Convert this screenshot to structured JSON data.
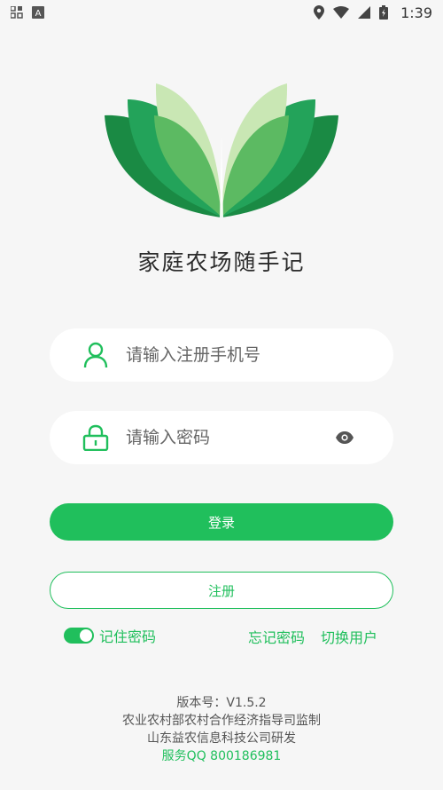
{
  "status_bar": {
    "icons_left": [
      "app-grid-icon",
      "a-badge-icon"
    ],
    "icons_right": [
      "location-icon",
      "wifi-icon",
      "signal-icon",
      "battery-icon"
    ],
    "time": "1:39"
  },
  "app": {
    "title": "家庭农场随手记",
    "logo_icon": "book-leaf-logo"
  },
  "form": {
    "phone_placeholder": "请输入注册手机号",
    "password_placeholder": "请输入密码",
    "phone_value": "",
    "password_value": ""
  },
  "buttons": {
    "login": "登录",
    "register": "注册"
  },
  "options": {
    "remember_label": "记住密码",
    "remember_on": true,
    "forgot_label": "忘记密码",
    "switch_user_label": "切换用户"
  },
  "footer": {
    "version": "版本号：V1.5.2",
    "supervisor": "农业农村部农村合作经济指导司监制",
    "developer": "山东益农信息科技公司研发",
    "service_qq": "服务QQ 800186981"
  },
  "colors": {
    "accent": "#20bf5c",
    "background": "#f6f6f6"
  }
}
